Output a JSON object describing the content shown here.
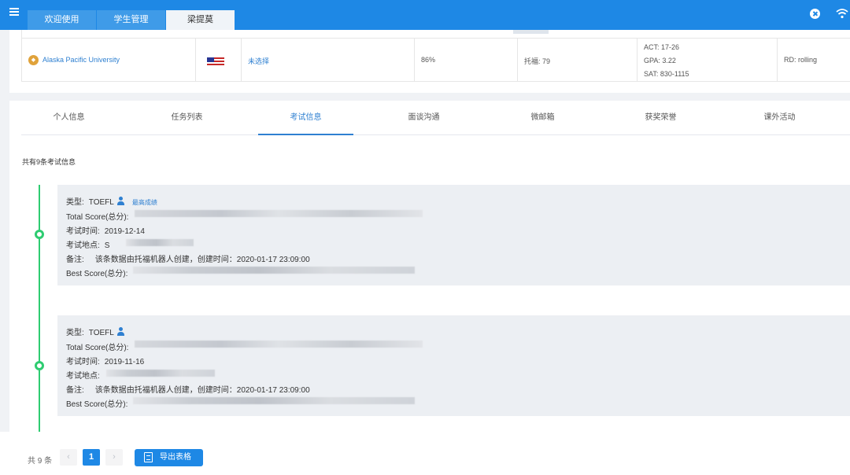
{
  "topbar": {
    "tabs": [
      {
        "label": "欢迎使用"
      },
      {
        "label": "学生管理"
      },
      {
        "label": "梁提莫"
      }
    ],
    "icons": [
      "menu-icon",
      "close-icon",
      "wifi-icon"
    ],
    "accent_color": "#1e88e5"
  },
  "school_row": {
    "name": "Alaska Pacific University",
    "logo_icon": "university-logo-icon",
    "flag_icon": "us-flag-icon",
    "major": "未选择",
    "rate": "86%",
    "toefl": "托福: 79",
    "act": "ACT:  17-26",
    "gpa": "GPA:  3.22",
    "sat": "SAT:  830-1115",
    "deadline": "RD: rolling"
  },
  "profile_tabs": [
    {
      "label": "个人信息"
    },
    {
      "label": "任务列表"
    },
    {
      "label": "考试信息"
    },
    {
      "label": "面谈沟通"
    },
    {
      "label": "微邮箱"
    },
    {
      "label": "获奖荣誉"
    },
    {
      "label": "课外活动"
    }
  ],
  "active_tab": "考试信息",
  "exam_count_text": "共有9条考试信息",
  "labels": {
    "type": "类型:",
    "total_score": "Total Score(总分):",
    "exam_date": "考试时间:",
    "exam_location": "考试地点:",
    "note": "备注:",
    "best_score": "Best Score(总分):",
    "best_badge": "最高成绩"
  },
  "records": [
    {
      "type": "TOEFL",
      "is_best": true,
      "date": "2019-12-14",
      "location_prefix": "S",
      "note": "该条数据由托福机器人创建，创建时间：2020-01-17 23:09:00"
    },
    {
      "type": "TOEFL",
      "is_best": false,
      "date": "2019-11-16",
      "location_prefix": "",
      "note": "该条数据由托福机器人创建，创建时间：2020-01-17 23:09:00"
    }
  ],
  "pagination": {
    "total_text": "共 9 条",
    "prev": "‹",
    "current": "1",
    "next": "›"
  },
  "export_button": "导出表格",
  "status_color": "#2ecc71"
}
